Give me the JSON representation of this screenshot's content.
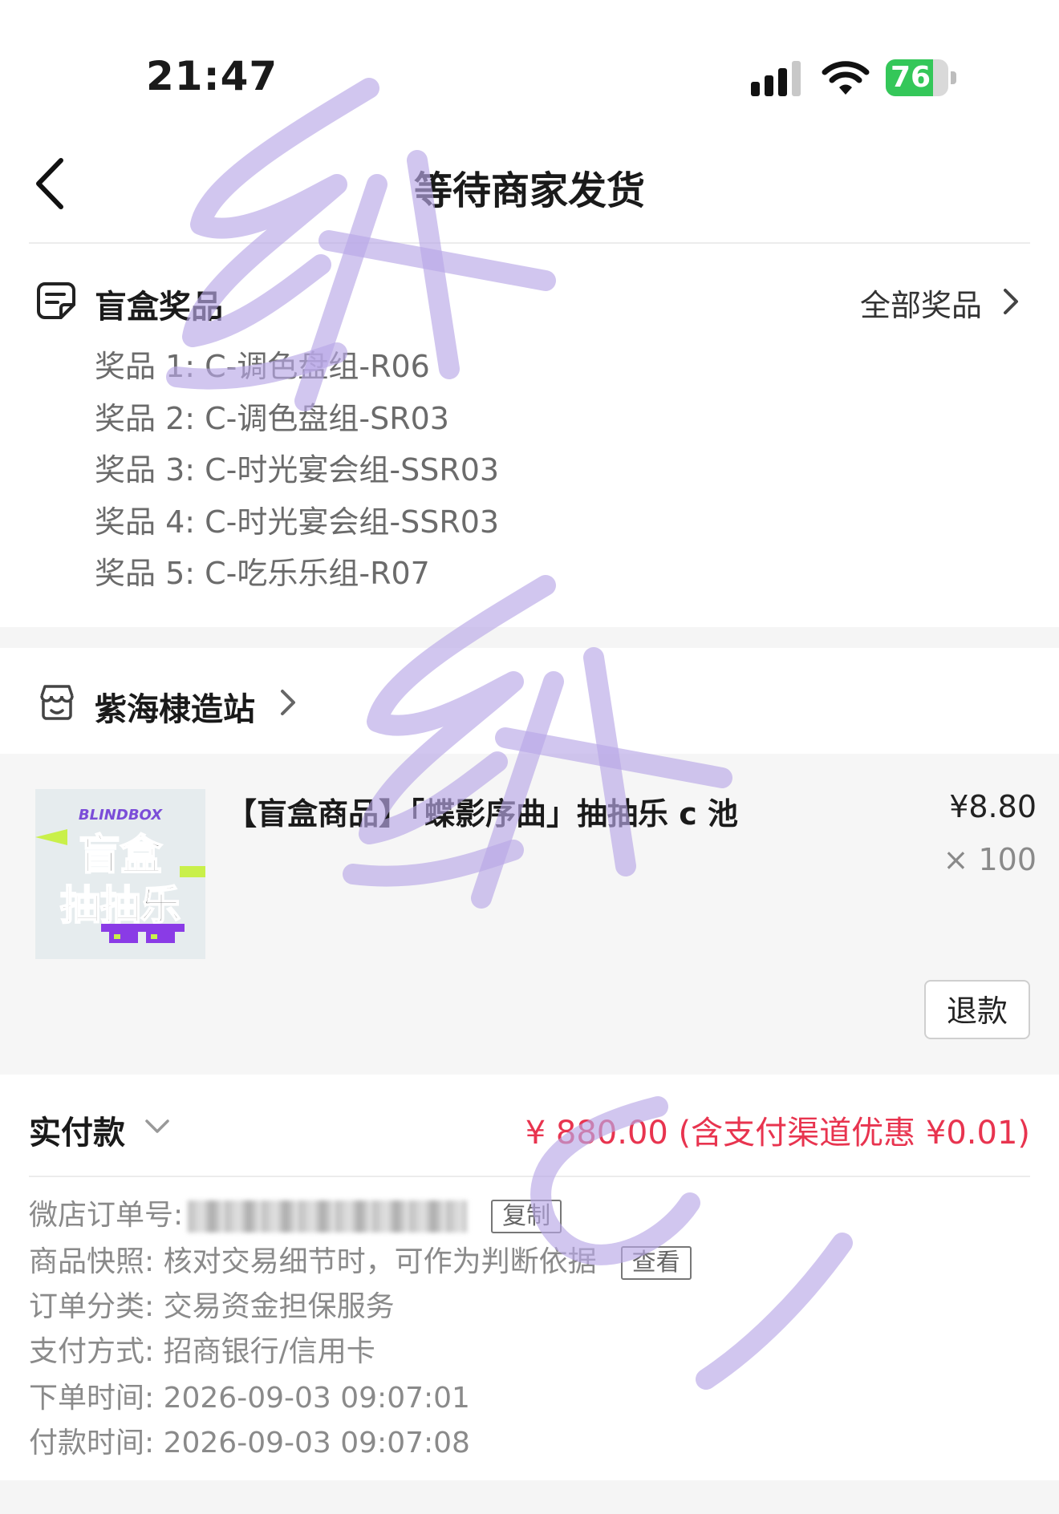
{
  "status_bar": {
    "time": "21:47",
    "battery": "76",
    "battery_level": 0.76,
    "signal_bars": 3
  },
  "nav": {
    "title": "等待商家发货"
  },
  "prizes": {
    "section_title": "盲盒奖品",
    "all_link": "全部奖品",
    "items": [
      "奖品 1: C-调色盘组-R06",
      "奖品 2: C-调色盘组-SR03",
      "奖品 3: C-时光宴会组-SSR03",
      "奖品 4: C-时光宴会组-SSR03",
      "奖品 5: C-吃乐乐组-R07"
    ]
  },
  "shop": {
    "name": "紫海棣造站"
  },
  "product": {
    "title": "【盲盒商品】「蝶影序曲」抽抽乐 c 池",
    "price": "¥8.80",
    "quantity": "× 100",
    "refund_label": "退款",
    "thumb": {
      "badge": "BLINDBOX",
      "line1": "盲盒",
      "line2": "抽抽乐"
    }
  },
  "payment": {
    "label": "实付款",
    "amount": "¥ 880.00 (含支付渠道优惠 ¥0.01)",
    "accent_color": "#e8344f"
  },
  "order_info": {
    "order_no_label": "微店订单号:",
    "copy_label": "复制",
    "snapshot_label": "商品快照:",
    "snapshot_text": "核对交易细节时，可作为判断依据",
    "view_label": "查看",
    "category_label": "订单分类:",
    "category_value": "交易资金担保服务",
    "pay_method_label": "支付方式:",
    "pay_method_value": "招商银行/信用卡",
    "order_time_label": "下单时间:",
    "order_time_value": "2026-09-03 09:07:01",
    "pay_time_label": "付款时间:",
    "pay_time_value": "2026-09-03 09:07:08"
  }
}
